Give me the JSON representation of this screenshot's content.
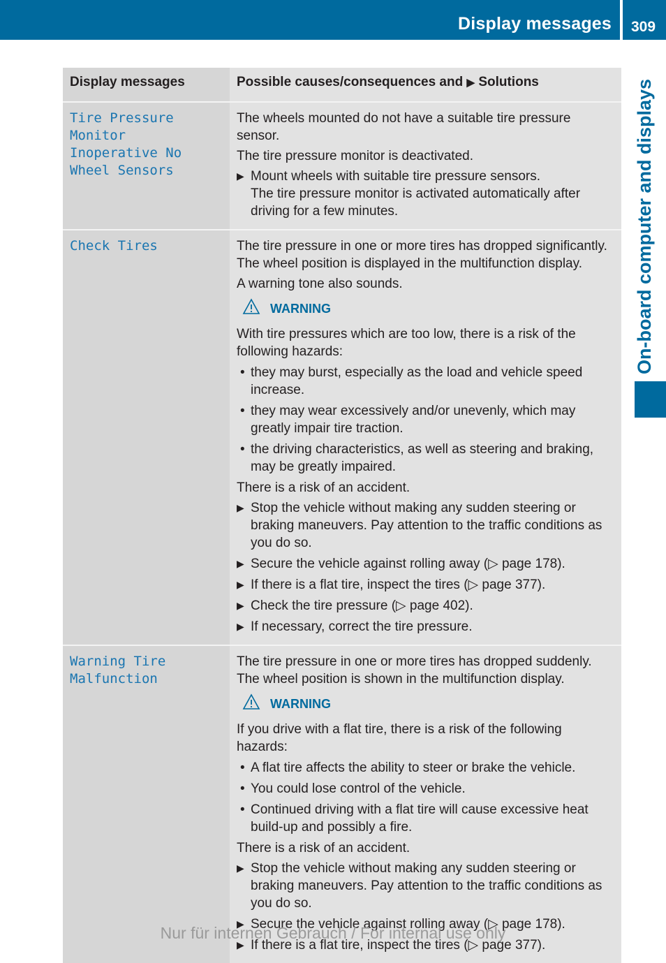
{
  "header": {
    "title": "Display messages",
    "page_number": "309"
  },
  "side_tab": {
    "label": "On-board computer and displays"
  },
  "table": {
    "headers": {
      "col1": "Display messages",
      "col2_before": "Possible causes/consequences and",
      "col2_after": "Solutions"
    },
    "rows": [
      {
        "message_lines": [
          "Tire Pressure",
          "Monitor",
          "Inoperative No",
          "Wheel Sensors"
        ],
        "intro": [
          "The wheels mounted do not have a suitable tire pressure sensor.",
          "The tire pressure monitor is deactivated."
        ],
        "steps": [
          {
            "text": "Mount wheels with suitable tire pressure sensors.",
            "note": "The tire pressure monitor is activated automatically after driving for a few minutes."
          }
        ]
      },
      {
        "message_lines": [
          "Check Tires"
        ],
        "intro": [
          "The tire pressure in one or more tires has dropped significantly. The wheel position is displayed in the multifunction display.",
          "A warning tone also sounds."
        ],
        "warning": {
          "label": "WARNING",
          "text": "With tire pressures which are too low, there is a risk of the following hazards:",
          "bullets": [
            "they may burst, especially as the load and vehicle speed increase.",
            "they may wear excessively and/or unevenly, which may greatly impair tire traction.",
            "the driving characteristics, as well as steering and braking, may be greatly impaired."
          ],
          "conclusion": "There is a risk of an accident."
        },
        "steps": [
          {
            "text": "Stop the vehicle without making any sudden steering or braking maneuvers. Pay attention to the traffic conditions as you do so."
          },
          {
            "text": "Secure the vehicle against rolling away (▷ page 178)."
          },
          {
            "text": "If there is a flat tire, inspect the tires (▷ page 377)."
          },
          {
            "text": "Check the tire pressure (▷ page 402)."
          },
          {
            "text": "If necessary, correct the tire pressure."
          }
        ]
      },
      {
        "message_lines": [
          "Warning Tire",
          "Malfunction"
        ],
        "intro": [
          "The tire pressure in one or more tires has dropped suddenly. The wheel position is shown in the multifunction display."
        ],
        "warning": {
          "label": "WARNING",
          "text": "If you drive with a flat tire, there is a risk of the following hazards:",
          "bullets": [
            "A flat tire affects the ability to steer or brake the vehicle.",
            "You could lose control of the vehicle.",
            "Continued driving with a flat tire will cause excessive heat build-up and possibly a fire."
          ],
          "conclusion": "There is a risk of an accident."
        },
        "steps": [
          {
            "text": "Stop the vehicle without making any sudden steering or braking maneuvers. Pay attention to the traffic conditions as you do so."
          },
          {
            "text": "Secure the vehicle against rolling away (▷ page 178)."
          },
          {
            "text": "If there is a flat tire, inspect the tires (▷ page 377)."
          }
        ]
      }
    ]
  },
  "footer": {
    "text": "Nur für internen Gebrauch / For internal use only"
  },
  "colors": {
    "brand_blue": "#006a9e",
    "message_blue": "#1a75b0",
    "col1_bg": "#d6d6d6",
    "col2_bg": "#e2e2e2"
  }
}
